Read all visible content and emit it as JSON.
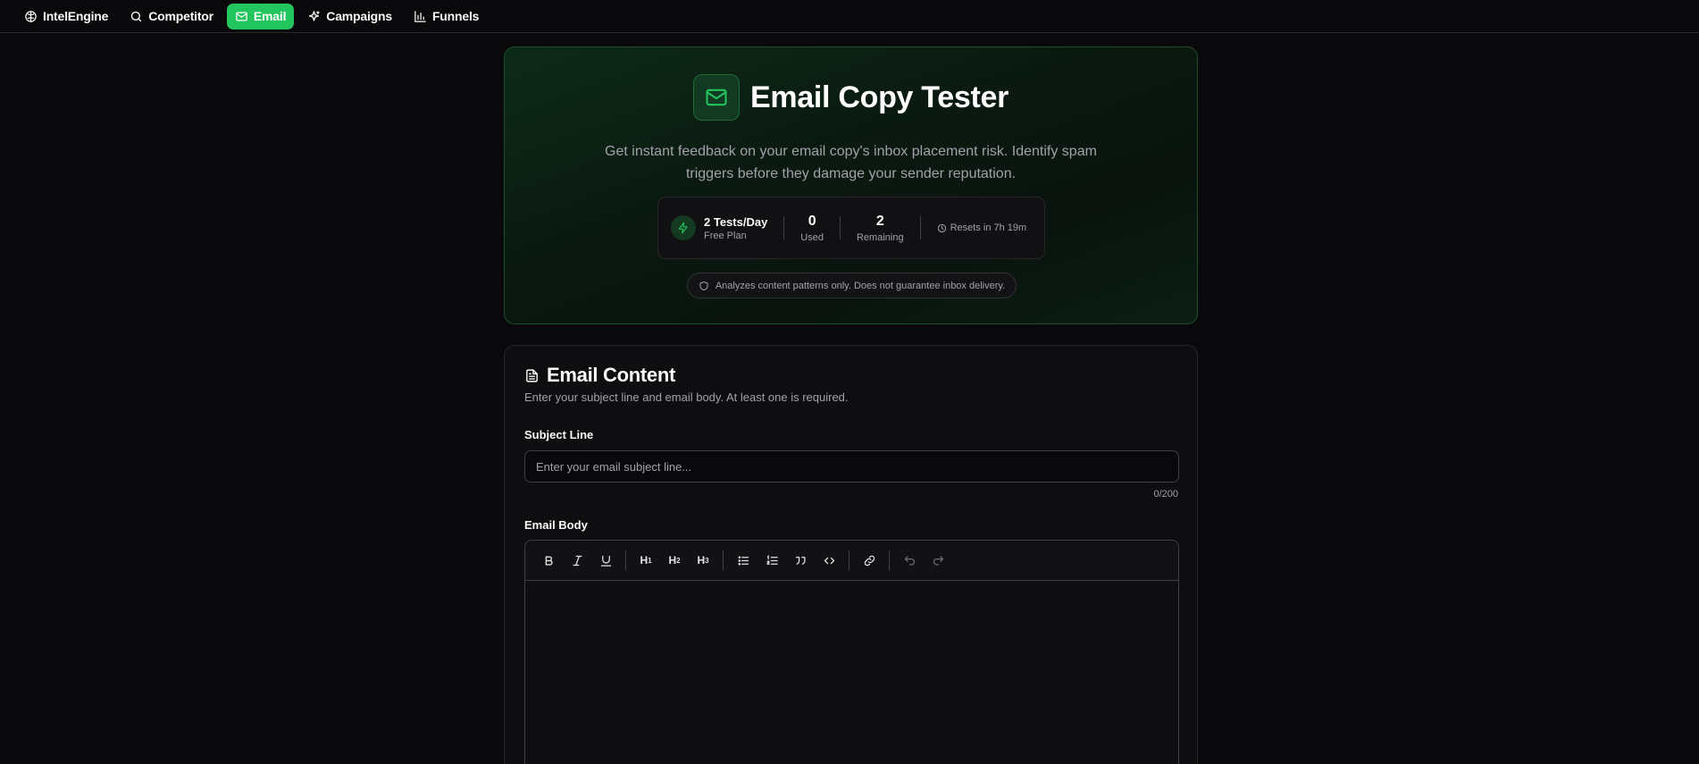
{
  "nav": {
    "items": [
      {
        "label": "IntelEngine",
        "icon": "brain-icon",
        "active": false
      },
      {
        "label": "Competitor",
        "icon": "search-icon",
        "active": false
      },
      {
        "label": "Email",
        "icon": "mail-icon",
        "active": true
      },
      {
        "label": "Campaigns",
        "icon": "sparkles-icon",
        "active": false
      },
      {
        "label": "Funnels",
        "icon": "bar-chart-icon",
        "active": false
      }
    ]
  },
  "hero": {
    "title": "Email Copy Tester",
    "description": "Get instant feedback on your email copy's inbox placement risk. Identify spam triggers before they damage your sender reputation.",
    "plan_name": "2 Tests/Day",
    "plan_sub": "Free Plan",
    "used_value": "0",
    "used_label": "Used",
    "remaining_value": "2",
    "remaining_label": "Remaining",
    "resets": "Resets in 7h 19m",
    "disclaimer": "Analyzes content patterns only. Does not guarantee inbox delivery."
  },
  "content": {
    "title": "Email Content",
    "description": "Enter your subject line and email body. At least one is required.",
    "subject_label": "Subject Line",
    "subject_placeholder": "Enter your email subject line...",
    "subject_value": "",
    "counter": "0/200",
    "body_label": "Email Body"
  },
  "toolbar": {
    "h1": "H",
    "h2": "H",
    "h3": "H",
    "h1_sub": "1",
    "h2_sub": "2",
    "h3_sub": "3"
  },
  "colors": {
    "accent": "#22c55e",
    "background": "#09090b",
    "card": "#0e0e10"
  }
}
